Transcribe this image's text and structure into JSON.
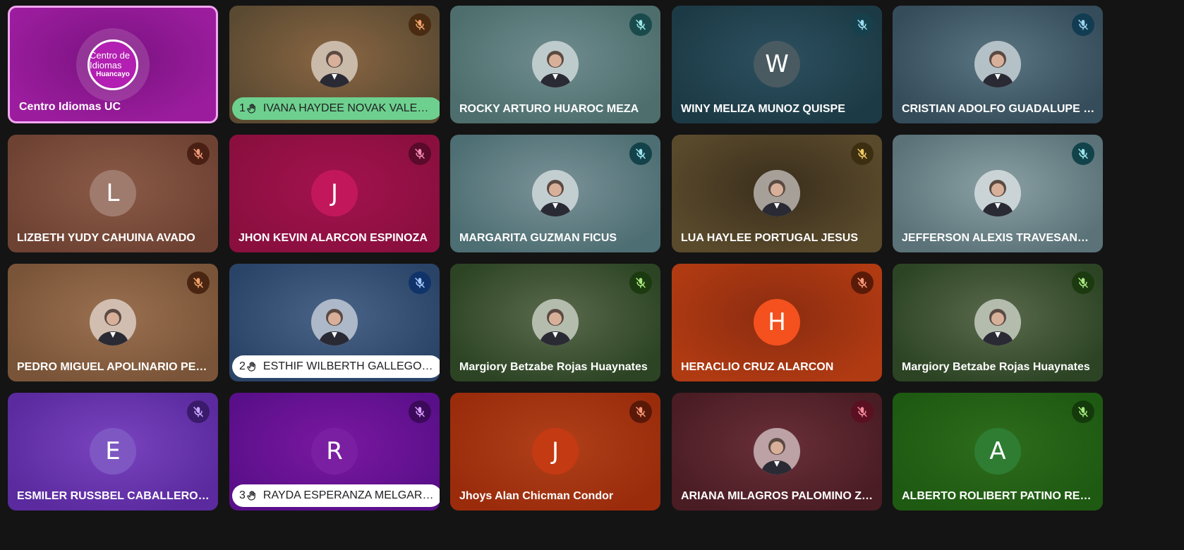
{
  "participants": [
    {
      "name": "Centro Idiomas UC",
      "avatar": "logo",
      "logo_line1": "Centro de Idiomas",
      "logo_line2": "Huancayo",
      "bg": [
        "#9b1d9e",
        "#7a1280"
      ],
      "active": true
    },
    {
      "name": "IVANA HAYDEE NOVAK VALENZUELA",
      "avatar": "photo",
      "bg": [
        "#5b4a32",
        "#8a6642"
      ],
      "mic_bg": "#4a2c12",
      "mic_color": "#f3a46b",
      "raised_hand": 1,
      "pill_bg": "#6ed08e"
    },
    {
      "name": "ROCKY ARTURO HUAROC MEZA",
      "avatar": "photo",
      "bg": [
        "#4d6e6d",
        "#6f8c8e"
      ],
      "mic_bg": "#1a4a4c",
      "mic_color": "#9be8e8"
    },
    {
      "name": "WINY MELIZA MUNOZ QUISPE",
      "avatar": "letter",
      "letter": "W",
      "avatar_bg": "#4a5a61",
      "bg": [
        "#1c3a45",
        "#2d5060"
      ],
      "mic_bg": "#15404c",
      "mic_color": "#9bdcf0"
    },
    {
      "name": "CRISTIAN ADOLFO GUADALUPE JULCARIMA",
      "avatar": "photo",
      "bg": [
        "#354c5a",
        "#5a7582"
      ],
      "mic_bg": "#123c52",
      "mic_color": "#9bd4f0"
    },
    {
      "name": "LIZBETH YUDY CAHUINA AVADO",
      "avatar": "letter",
      "letter": "L",
      "avatar_bg": "#9e7b6d",
      "bg": [
        "#6e4233",
        "#8a5a46"
      ],
      "mic_bg": "#4a2014",
      "mic_color": "#f39a7a"
    },
    {
      "name": "JHON KEVIN ALARCON ESPINOZA",
      "avatar": "letter",
      "letter": "J",
      "avatar_bg": "#c2185b",
      "bg": [
        "#8a0f3f",
        "#a3124e"
      ],
      "mic_bg": "#5a0a2a",
      "mic_color": "#f28ab0"
    },
    {
      "name": "MARGARITA GUZMAN FICUS",
      "avatar": "photo",
      "bg": [
        "#4d6e72",
        "#7a9298"
      ],
      "mic_bg": "#14424a",
      "mic_color": "#9be6ee"
    },
    {
      "name": "LUA HAYLEE PORTUGAL JESUS",
      "avatar": "photo",
      "bg": [
        "#5a4a2c",
        "#3a2e1c"
      ],
      "mic_bg": "#3c2e10",
      "mic_color": "#f0c860"
    },
    {
      "name": "JEFFERSON ALEXIS TRAVESANO VILLALVA",
      "avatar": "photo",
      "bg": [
        "#5a7278",
        "#8aa0a4"
      ],
      "mic_bg": "#12434a",
      "mic_color": "#9be6ee"
    },
    {
      "name": "PEDRO MIGUEL APOLINARIO PENA",
      "avatar": "photo",
      "bg": [
        "#7a5438",
        "#9a7050"
      ],
      "mic_bg": "#4a2612",
      "mic_color": "#f3a46b"
    },
    {
      "name": "ESTHIF WILBERTH GALLEGOS BALDEON",
      "avatar": "photo",
      "bg": [
        "#2a4468",
        "#4a6488"
      ],
      "mic_bg": "#10336a",
      "mic_color": "#a8c8ff",
      "raised_hand": 2,
      "pill_bg": "#ffffff"
    },
    {
      "name": "Margiory Betzabe Rojas Huaynates",
      "avatar": "photo",
      "bg": [
        "#2c4424",
        "#5a6a4c"
      ],
      "mic_bg": "#1c3a10",
      "mic_color": "#a8e880"
    },
    {
      "name": "HERACLIO CRUZ ALARCON",
      "avatar": "letter",
      "letter": "H",
      "avatar_bg": "#f4511e",
      "bg": [
        "#b03a12",
        "#8a2c10"
      ],
      "mic_bg": "#5a1a08",
      "mic_color": "#f89a7a"
    },
    {
      "name": "Margiory Betzabe Rojas Huaynates",
      "avatar": "photo",
      "bg": [
        "#2c4424",
        "#5a6a4c"
      ],
      "mic_bg": "#1c3a10",
      "mic_color": "#a8e880"
    },
    {
      "name": "ESMILER RUSSBEL CABALLERO HUAMAN",
      "avatar": "letter",
      "letter": "E",
      "avatar_bg": "#7e57c2",
      "bg": [
        "#5a2a9e",
        "#7a44c0"
      ],
      "mic_bg": "#3a1a6a",
      "mic_color": "#c9a8ff"
    },
    {
      "name": "RAYDA ESPERANZA MELGAREJO QUISPE",
      "avatar": "letter",
      "letter": "R",
      "avatar_bg": "#7b1fa2",
      "bg": [
        "#5a0f8a",
        "#7a18a0"
      ],
      "mic_bg": "#3c0a5a",
      "mic_color": "#d8a0ff",
      "raised_hand": 3,
      "pill_bg": "#ffffff"
    },
    {
      "name": "Jhoys Alan Chicman Condor",
      "avatar": "letter",
      "letter": "J",
      "avatar_bg": "#c43a12",
      "bg": [
        "#9a2c0c",
        "#b0401a"
      ],
      "mic_bg": "#5a1808",
      "mic_color": "#f89a7a"
    },
    {
      "name": "ARIANA MILAGROS PALOMINO ZAPATA",
      "avatar": "photo",
      "bg": [
        "#4a1c24",
        "#6a3038"
      ],
      "mic_bg": "#5a1020",
      "mic_color": "#f28a9a"
    },
    {
      "name": "ALBERTO ROLIBERT PATINO REYNOSO",
      "avatar": "letter",
      "letter": "A",
      "avatar_bg": "#2e7d32",
      "bg": [
        "#1e5a12",
        "#2e6c1c"
      ],
      "mic_bg": "#143a0c",
      "mic_color": "#a8e880"
    }
  ]
}
